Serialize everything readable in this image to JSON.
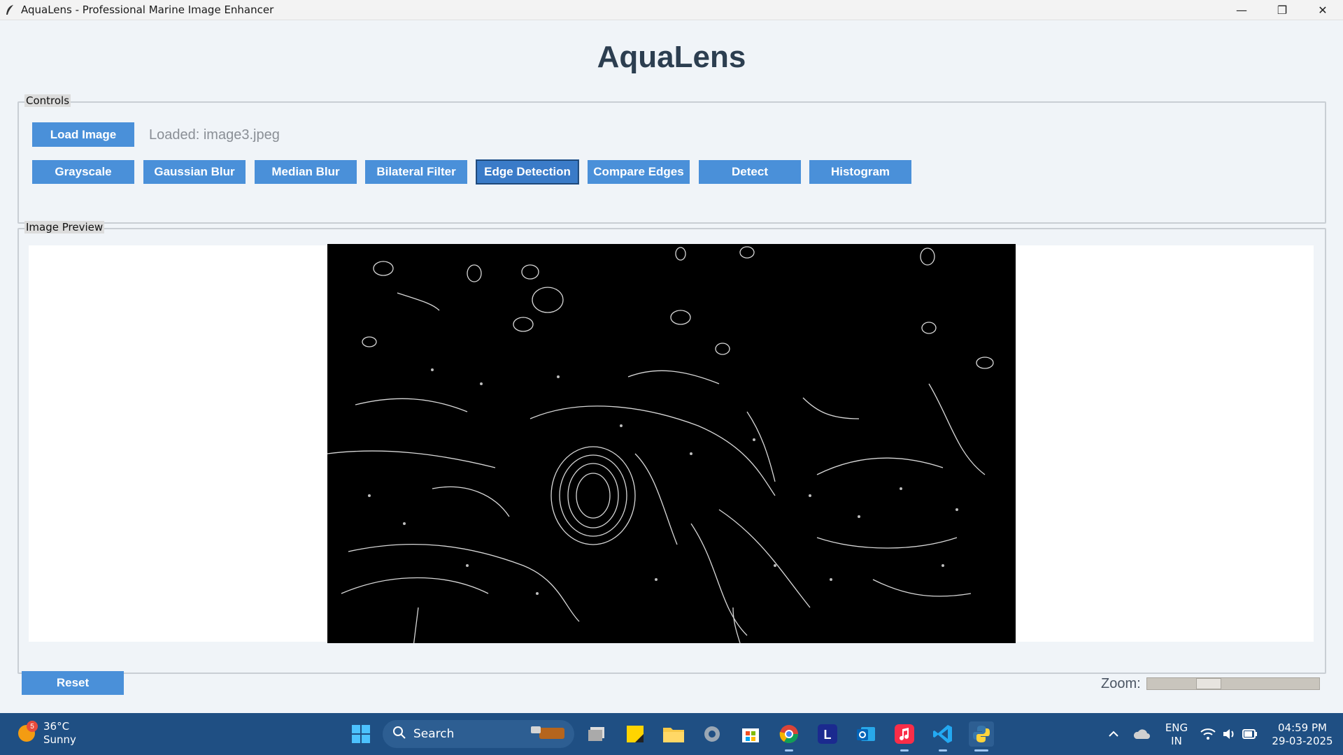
{
  "window": {
    "title": "AquaLens - Professional Marine Image Enhancer",
    "minimize_glyph": "—",
    "restore_glyph": "❐",
    "close_glyph": "✕"
  },
  "app": {
    "heading": "AquaLens"
  },
  "controls": {
    "label": "Controls",
    "load_button": "Load Image",
    "loaded_status": "Loaded: image3.jpeg",
    "buttons": [
      "Grayscale",
      "Gaussian Blur",
      "Median Blur",
      "Bilateral Filter",
      "Edge Detection",
      "Compare Edges",
      "Detect",
      "Histogram"
    ],
    "active_button": "Edge Detection"
  },
  "preview": {
    "label": "Image Preview"
  },
  "footer": {
    "reset_button": "Reset",
    "zoom_label": "Zoom:",
    "zoom_level": 0.36
  },
  "taskbar": {
    "weather_badge": "5",
    "temperature": "36°C",
    "condition": "Sunny",
    "search_label": "Search",
    "lang_1": "ENG",
    "lang_2": "IN",
    "time": "04:59 PM",
    "date": "29-03-2025",
    "launcher_letter": "L",
    "icons": [
      "windows-start-icon",
      "search-icon",
      "task-view-icon",
      "sticky-notes-icon",
      "file-explorer-icon",
      "settings-icon",
      "microsoft-store-icon",
      "chrome-icon",
      "l-app-icon",
      "outlook-icon",
      "itunes-icon",
      "vscode-icon",
      "python-icon"
    ]
  },
  "colors": {
    "button": "#4a90d9",
    "heading": "#2c3e50",
    "taskbar": "#1f4f83"
  }
}
